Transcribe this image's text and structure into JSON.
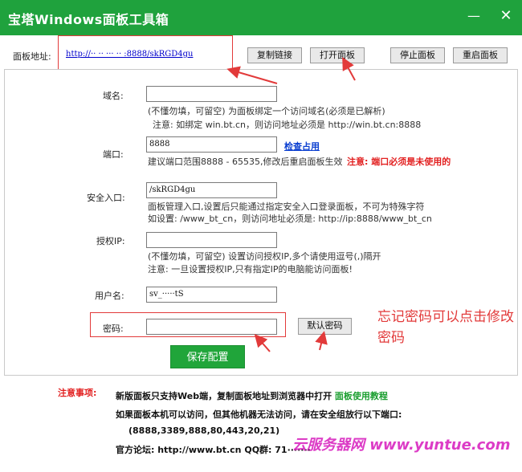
{
  "window": {
    "title": "宝塔Windows面板工具箱",
    "minimize": "—",
    "close": "✕"
  },
  "toolbar": {
    "address_label": "面板地址:",
    "address_value": "http://·· ·· ···  ··   :8888/skRGD4gu",
    "copy_label": "复制链接",
    "open_label": "打开面板",
    "stop_label": "停止面板",
    "restart_label": "重启面板"
  },
  "form": {
    "domain": {
      "label": "域名:",
      "value": "",
      "hint1": "(不懂勿填，可留空) 为面板绑定一个访问域名(必须是已解析)",
      "hint2": "注意: 如绑定 win.bt.cn，则访问地址必须是 http://win.bt.cn:8888"
    },
    "port": {
      "label": "端口:",
      "value": "8888",
      "check_link": "检查占用",
      "hint": "建议端口范围8888 - 65535,修改后重启面板生效",
      "warn": "注意: 端口必须是未使用的"
    },
    "entry": {
      "label": "安全入口:",
      "value": "/skRGD4gu",
      "hint1": "面板管理入口,设置后只能通过指定安全入口登录面板，不可为特殊字符",
      "hint2": "如设置: /www_bt_cn，则访问地址必须是: http://ip:8888/www_bt_cn"
    },
    "auth_ip": {
      "label": "授权IP:",
      "value": "",
      "hint1": "(不懂勿填，可留空) 设置访问授权IP,多个请使用逗号(,)隔开",
      "hint2": "注意: 一旦设置授权IP,只有指定IP的电脑能访问面板!"
    },
    "username": {
      "label": "用户名:",
      "value": "sv_·····tS"
    },
    "password": {
      "label": "密码:",
      "value": "",
      "default_label": "默认密码"
    },
    "save_label": "保存配置"
  },
  "annotation": "忘记密码可以点击修改密码",
  "notes": {
    "title": "注意事项:",
    "line1": "新版面板只支持Web端，复制面板地址到浏览器中打开",
    "line1_link": "面板使用教程",
    "line2": "如果面板本机可以访问，但其他机器无法访问，请在安全组放行以下端口:",
    "line3": "(8888,3389,888,80,443,20,21)",
    "line4": "官方论坛: http://www.bt.cn   QQ群: 71·······"
  },
  "watermark": "云服务器网 www.yuntue.com",
  "colors": {
    "titlebar": "#1fa23d",
    "save_button": "#20a53a",
    "annotation_red": "#e23a3a",
    "link_blue": "#0b3fd0"
  }
}
